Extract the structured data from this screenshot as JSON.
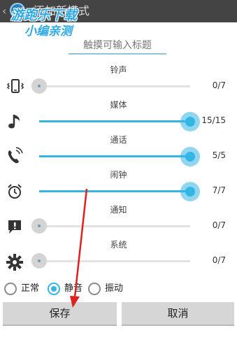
{
  "actionbar": {
    "back_glyph": "‹",
    "title": "添加新模式",
    "icon": "app-icon"
  },
  "watermark": {
    "line1": "游跑乐下载",
    "line2": "小编亲测"
  },
  "title_input": {
    "value": "",
    "placeholder": "触摸可输入标题"
  },
  "volumes": [
    {
      "id": "ringtone",
      "label": "铃声",
      "icon": "vibrate-phone-icon",
      "value": 0,
      "max": 7,
      "display": "0/7"
    },
    {
      "id": "media",
      "label": "媒体",
      "icon": "music-note-icon",
      "value": 15,
      "max": 15,
      "display": "15/15"
    },
    {
      "id": "call",
      "label": "通话",
      "icon": "phone-icon",
      "value": 5,
      "max": 5,
      "display": "5/5"
    },
    {
      "id": "alarm",
      "label": "闹钟",
      "icon": "alarm-clock-icon",
      "value": 7,
      "max": 7,
      "display": "7/7"
    },
    {
      "id": "notification",
      "label": "通知",
      "icon": "notification-icon",
      "value": 0,
      "max": 7,
      "display": "0/7"
    },
    {
      "id": "system",
      "label": "系统",
      "icon": "gear-icon",
      "value": 0,
      "max": 7,
      "display": "0/7"
    }
  ],
  "mode_options": [
    {
      "label": "正常",
      "checked": false
    },
    {
      "label": "静音",
      "checked": true
    },
    {
      "label": "振动",
      "checked": false
    }
  ],
  "buttons": {
    "save": "保存",
    "cancel": "取消"
  },
  "colors": {
    "accent": "#34b5e5",
    "actionbar": "#444444",
    "annotation_arrow": "#e0201c"
  }
}
